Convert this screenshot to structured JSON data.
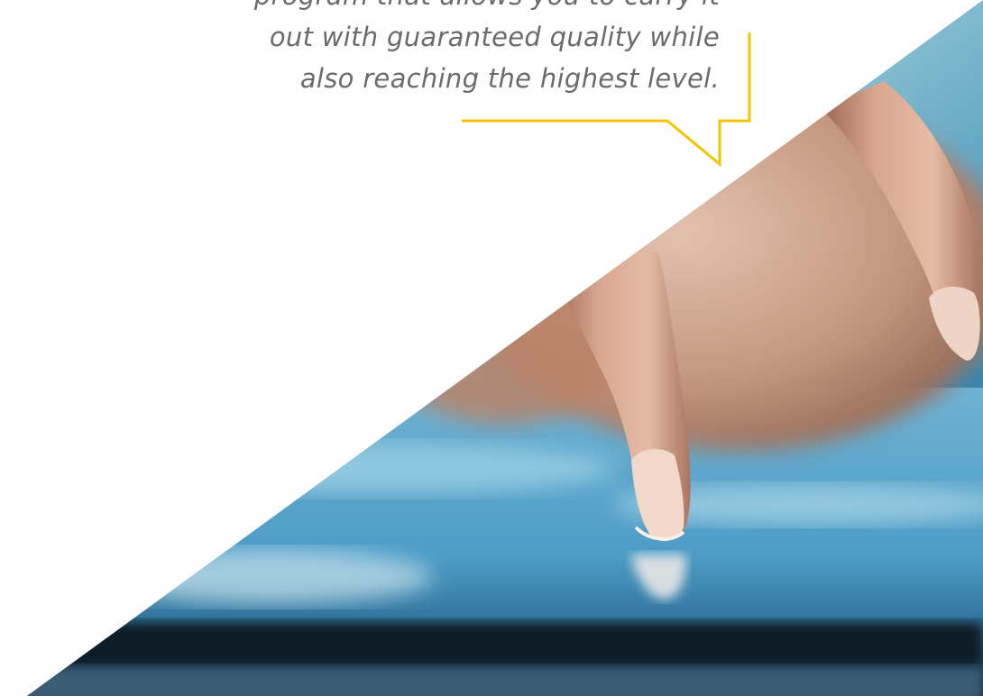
{
  "quote": {
    "lines": [
      "program that allows you to carry it",
      "out with guaranteed quality while",
      "also reaching the highest level."
    ]
  },
  "colors": {
    "accent": "#f2c500",
    "text": "#6b6b6b",
    "background": "#ffffff"
  },
  "image": {
    "subject": "finger-touching-tablet-photo"
  }
}
